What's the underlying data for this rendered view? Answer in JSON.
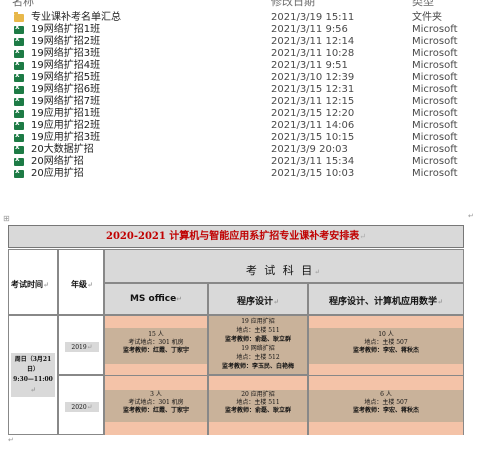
{
  "file_list": {
    "columns": {
      "name": "名称",
      "date": "修改日期",
      "type": "类型"
    },
    "rows": [
      {
        "icon": "folder-icon",
        "name": "专业课补考名单汇总",
        "date": "2021/3/19 15:11",
        "type": "文件夹"
      },
      {
        "icon": "excel-icon",
        "name": "19网络扩招1班",
        "date": "2021/3/11 9:56",
        "type": "Microsoft"
      },
      {
        "icon": "excel-icon",
        "name": "19网络扩招2班",
        "date": "2021/3/11 12:14",
        "type": "Microsoft"
      },
      {
        "icon": "excel-icon",
        "name": "19网络扩招3班",
        "date": "2021/3/11 10:28",
        "type": "Microsoft"
      },
      {
        "icon": "excel-icon",
        "name": "19网络扩招4班",
        "date": "2021/3/11 9:51",
        "type": "Microsoft"
      },
      {
        "icon": "excel-icon",
        "name": "19网络扩招5班",
        "date": "2021/3/10 12:39",
        "type": "Microsoft"
      },
      {
        "icon": "excel-icon",
        "name": "19网络扩招6班",
        "date": "2021/3/15 12:31",
        "type": "Microsoft"
      },
      {
        "icon": "excel-icon",
        "name": "19网络扩招7班",
        "date": "2021/3/11 12:15",
        "type": "Microsoft"
      },
      {
        "icon": "excel-icon",
        "name": "19应用扩招1班",
        "date": "2021/3/15 12:20",
        "type": "Microsoft"
      },
      {
        "icon": "excel-icon",
        "name": "19应用扩招2班",
        "date": "2021/3/11 14:06",
        "type": "Microsoft"
      },
      {
        "icon": "excel-icon",
        "name": "19应用扩招3班",
        "date": "2021/3/15 10:15",
        "type": "Microsoft"
      },
      {
        "icon": "excel-icon",
        "name": "20大数据扩招",
        "date": "2021/3/9 20:03",
        "type": "Microsoft"
      },
      {
        "icon": "excel-icon",
        "name": "20网络扩招",
        "date": "2021/3/11 15:34",
        "type": "Microsoft"
      },
      {
        "icon": "excel-icon",
        "name": "20应用扩招",
        "date": "2021/3/15 10:03",
        "type": "Microsoft"
      }
    ]
  },
  "document": {
    "title": "2020-2021 计算机与智能应用系扩招专业课补考安排表",
    "ret_mark": "↵",
    "headers": {
      "time": "考试时间",
      "grade": "年级",
      "subjects": "考 试 科 目",
      "ms_office": "MS office",
      "programming": "程序设计",
      "prog_math": "程序设计、计算机应用数学"
    },
    "exam_time": {
      "line1": "周日（3月21",
      "line2": "日）",
      "line3": "9:30—11:00"
    },
    "grade_2019": "2019",
    "grade_2020": "2020",
    "cells_2019": {
      "ms_office": [
        "15 人",
        "考试地点：301 机房",
        "监考教师：红霞、丁家宇"
      ],
      "programming": [
        "19 应用扩招",
        "地点：主楼 511",
        "监考教师：俞磊、耿立群",
        "19 网络扩招",
        "地点：主楼 512",
        "监考教师：李玉民、白艳梅"
      ],
      "prog_math": [
        "10 人",
        "地点：主楼 507",
        "监考教师：李宏、蒋秋杰"
      ]
    },
    "cells_2020": {
      "ms_office": [
        "3 人",
        "考试地点：301 机房",
        "监考教师：红霞、丁家宇"
      ],
      "programming": [
        "20 应用扩招",
        "地点：主楼 511",
        "监考教师：俞磊、耿立群"
      ],
      "prog_math": [
        "6 人",
        "地点：主楼 507",
        "监考教师：李宏、蒋秋杰"
      ]
    }
  }
}
